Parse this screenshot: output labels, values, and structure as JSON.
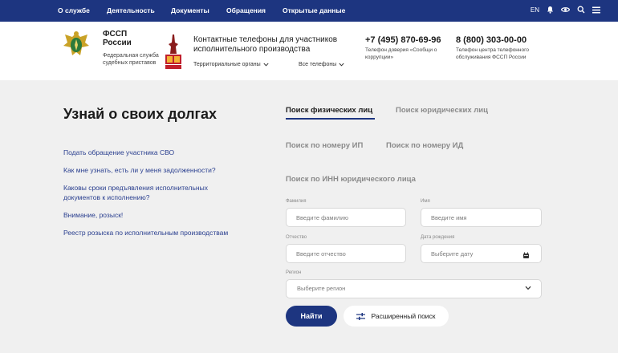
{
  "topnav": {
    "items": [
      "О службе",
      "Деятельность",
      "Документы",
      "Обращения",
      "Открытые данные"
    ],
    "lang": "EN"
  },
  "header": {
    "org_name_line1": "ФССП",
    "org_name_line2": "России",
    "org_sub": "Федеральная служба судебных приставов",
    "contacts_title": "Контактные телефоны для участников исполнительного производства",
    "territorial": "Территориальные органы",
    "all_phones": "Все телефоны",
    "phone1": "+7 (495) 870-69-96",
    "phone1_desc": "Телефон доверия «Сообщи о коррупции»",
    "phone2": "8 (800) 303-00-00",
    "phone2_desc": "Телефон центра телефонного обслуживания ФССП России"
  },
  "main": {
    "title": "Узнай о своих долгах",
    "links": [
      "Подать обращение участника СВО",
      "Как мне узнать, есть ли у меня задолженности?",
      "Каковы сроки предъявления исполнительных документов к исполнению?",
      "Внимание, розыск!",
      "Реестр розыска по исполнительным производствам"
    ]
  },
  "search": {
    "tabs": [
      "Поиск физических лиц",
      "Поиск юридических лиц",
      "Поиск по номеру ИП",
      "Поиск по номеру ИД",
      "Поиск по ИНН юридического лица"
    ],
    "labels": {
      "surname": "Фамилия",
      "name": "Имя",
      "patronymic": "Отчество",
      "birthdate": "Дата рождения",
      "region": "Регион"
    },
    "placeholders": {
      "surname": "Введите фамилию",
      "name": "Введите имя",
      "patronymic": "Введите отчество",
      "birthdate": "Выберите дату"
    },
    "region_placeholder": "Выберите регион",
    "find_button": "Найти",
    "advanced_button": "Расширенный поиск"
  },
  "colors": {
    "brand": "#1d3580",
    "link": "#2a3f8f",
    "background": "#f0f0f0"
  },
  "icons": [
    "emblem-icon",
    "victory-80-icon",
    "bell-icon",
    "eye-icon",
    "search-icon",
    "menu-icon",
    "chevron-down-icon",
    "calendar-icon",
    "filter-icon"
  ]
}
